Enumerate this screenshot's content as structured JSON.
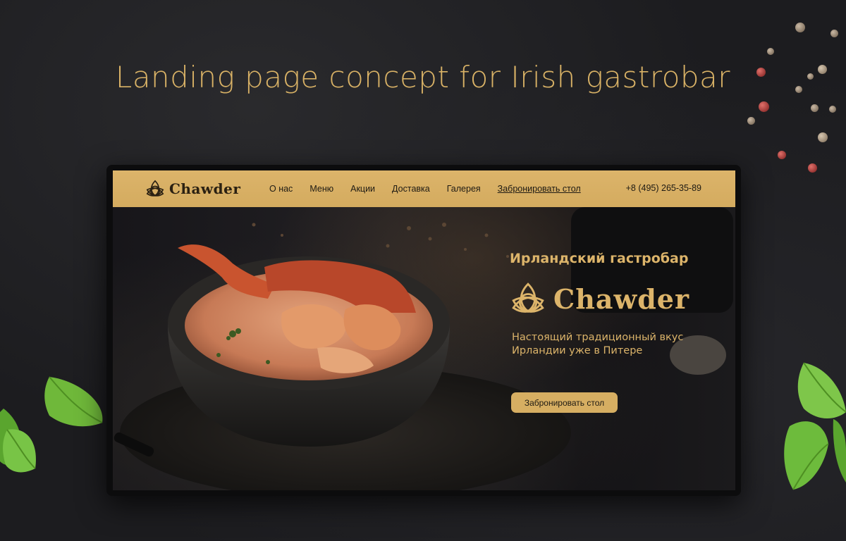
{
  "headline": "Landing page concept for Irish gastrobar",
  "site": {
    "brand": "Chawder",
    "nav": {
      "items": [
        "О нас",
        "Меню",
        "Акции",
        "Доставка",
        "Галерея",
        "Забронировать стол"
      ],
      "phone": "+8 (495) 265-35-89"
    },
    "hero": {
      "title": "Ирландский гастробар",
      "brand": "Chawder",
      "subtitle_line1": "Настоящий традиционный вкус",
      "subtitle_line2": "Ирландии уже в Питере",
      "cta": "Забронировать стол"
    }
  },
  "colors": {
    "accent_gold": "#dcb46a",
    "background": "#1c1c1f",
    "nav_text": "#1e1a13"
  },
  "icons": [
    "triquetra-logo-icon",
    "bowl-illustration",
    "basil-leaf",
    "peppercorn"
  ]
}
